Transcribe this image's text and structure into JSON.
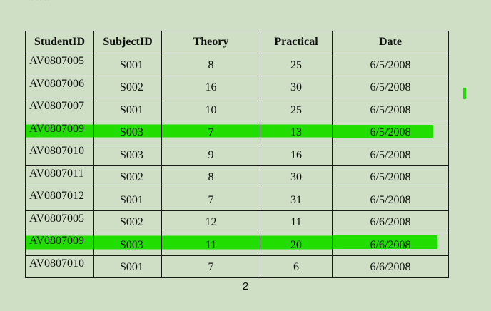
{
  "table": {
    "headers": [
      "StudentID",
      "SubjectID",
      "Theory",
      "Practical",
      "Date"
    ],
    "rows": [
      {
        "student_id": "AV0807005",
        "subject_id": "S001",
        "theory": "8",
        "practical": "25",
        "date": "6/5/2008",
        "highlighted": false
      },
      {
        "student_id": "AV0807006",
        "subject_id": "S002",
        "theory": "16",
        "practical": "30",
        "date": "6/5/2008",
        "highlighted": false
      },
      {
        "student_id": "AV0807007",
        "subject_id": "S001",
        "theory": "10",
        "practical": "25",
        "date": "6/5/2008",
        "highlighted": false
      },
      {
        "student_id": "AV0807009",
        "subject_id": "S003",
        "theory": "7",
        "practical": "13",
        "date": "6/5/2008",
        "highlighted": true
      },
      {
        "student_id": "AV0807010",
        "subject_id": "S003",
        "theory": "9",
        "practical": "16",
        "date": "6/5/2008",
        "highlighted": false
      },
      {
        "student_id": "AV0807011",
        "subject_id": "S002",
        "theory": "8",
        "practical": "30",
        "date": "6/5/2008",
        "highlighted": false
      },
      {
        "student_id": "AV0807012",
        "subject_id": "S001",
        "theory": "7",
        "practical": "31",
        "date": "6/5/2008",
        "highlighted": false
      },
      {
        "student_id": "AV0807005",
        "subject_id": "S002",
        "theory": "12",
        "practical": "11",
        "date": "6/6/2008",
        "highlighted": false
      },
      {
        "student_id": "AV0807009",
        "subject_id": "S003",
        "theory": "11",
        "practical": "20",
        "date": "6/6/2008",
        "highlighted": true
      },
      {
        "student_id": "AV0807010",
        "subject_id": "S001",
        "theory": "7",
        "practical": "6",
        "date": "6/6/2008",
        "highlighted": false
      }
    ]
  },
  "page_number": "2",
  "colors": {
    "background": "#cfdfc5",
    "highlight": "#22dd00",
    "text": "#111111"
  }
}
